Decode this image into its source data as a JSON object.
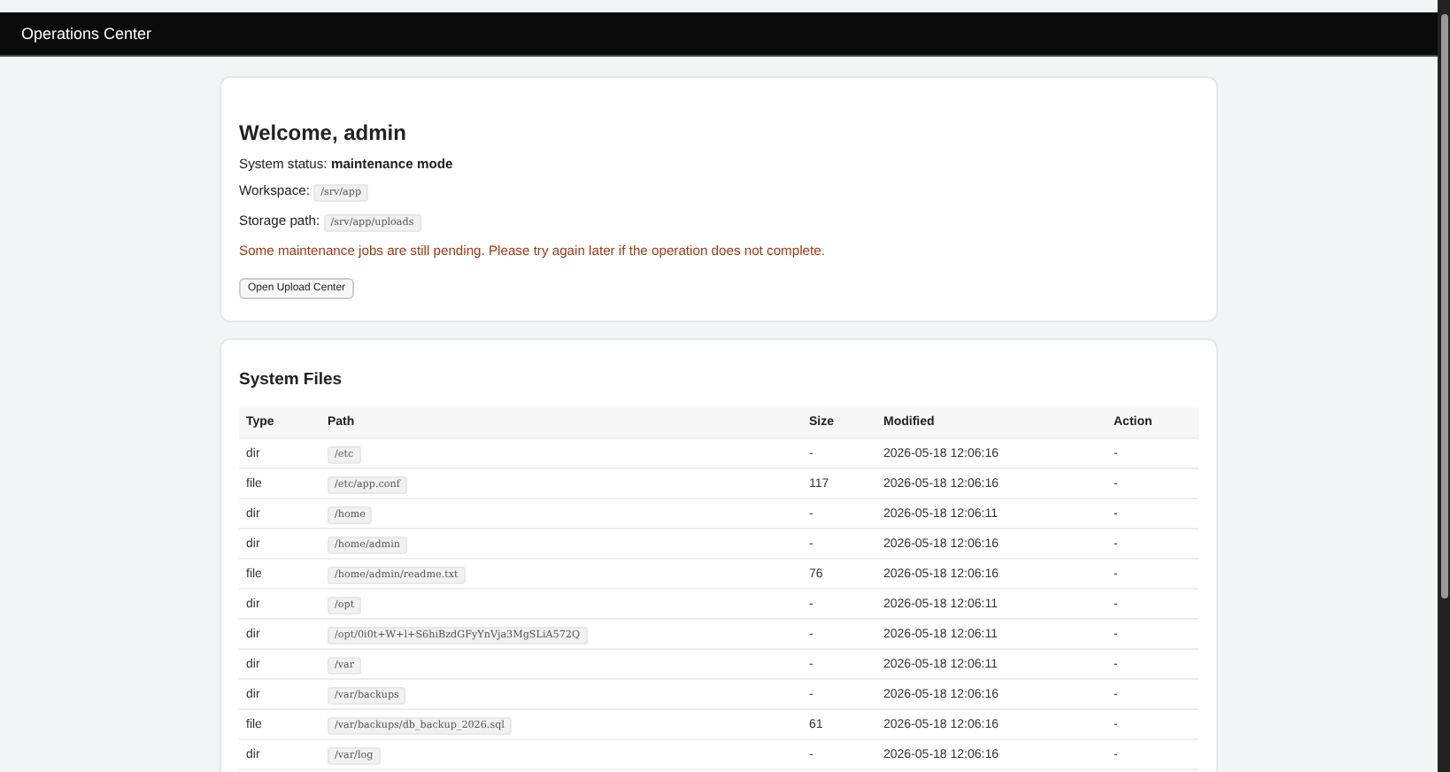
{
  "header": {
    "title": "Operations Center"
  },
  "welcome": {
    "title": "Welcome, admin",
    "status_label": "System status:",
    "status_value": "maintenance mode",
    "workspace_label": "Workspace:",
    "workspace_value": "/srv/app",
    "storage_label": "Storage path:",
    "storage_value": "/srv/app/uploads",
    "warning": "Some maintenance jobs are still pending. Please try again later if the operation does not complete.",
    "button": "Open Upload Center"
  },
  "files": {
    "title": "System Files",
    "columns": [
      "Type",
      "Path",
      "Size",
      "Modified",
      "Action"
    ],
    "rows": [
      {
        "type": "dir",
        "path": "/etc",
        "size": "-",
        "modified": "2026-05-18 12:06:16",
        "action": "-"
      },
      {
        "type": "file",
        "path": "/etc/app.conf",
        "size": "117",
        "modified": "2026-05-18 12:06:16",
        "action": "-"
      },
      {
        "type": "dir",
        "path": "/home",
        "size": "-",
        "modified": "2026-05-18 12:06:11",
        "action": "-"
      },
      {
        "type": "dir",
        "path": "/home/admin",
        "size": "-",
        "modified": "2026-05-18 12:06:16",
        "action": "-"
      },
      {
        "type": "file",
        "path": "/home/admin/readme.txt",
        "size": "76",
        "modified": "2026-05-18 12:06:16",
        "action": "-"
      },
      {
        "type": "dir",
        "path": "/opt",
        "size": "-",
        "modified": "2026-05-18 12:06:11",
        "action": "-"
      },
      {
        "type": "dir",
        "path": "/opt/0i0t+W+l+S6hiBzdGFyYnVja3MgSLiA572Q",
        "size": "-",
        "modified": "2026-05-18 12:06:11",
        "action": "-"
      },
      {
        "type": "dir",
        "path": "/var",
        "size": "-",
        "modified": "2026-05-18 12:06:11",
        "action": "-"
      },
      {
        "type": "dir",
        "path": "/var/backups",
        "size": "-",
        "modified": "2026-05-18 12:06:16",
        "action": "-"
      },
      {
        "type": "file",
        "path": "/var/backups/db_backup_2026.sql",
        "size": "61",
        "modified": "2026-05-18 12:06:16",
        "action": "-"
      },
      {
        "type": "dir",
        "path": "/var/log",
        "size": "-",
        "modified": "2026-05-18 12:06:16",
        "action": "-"
      }
    ]
  }
}
